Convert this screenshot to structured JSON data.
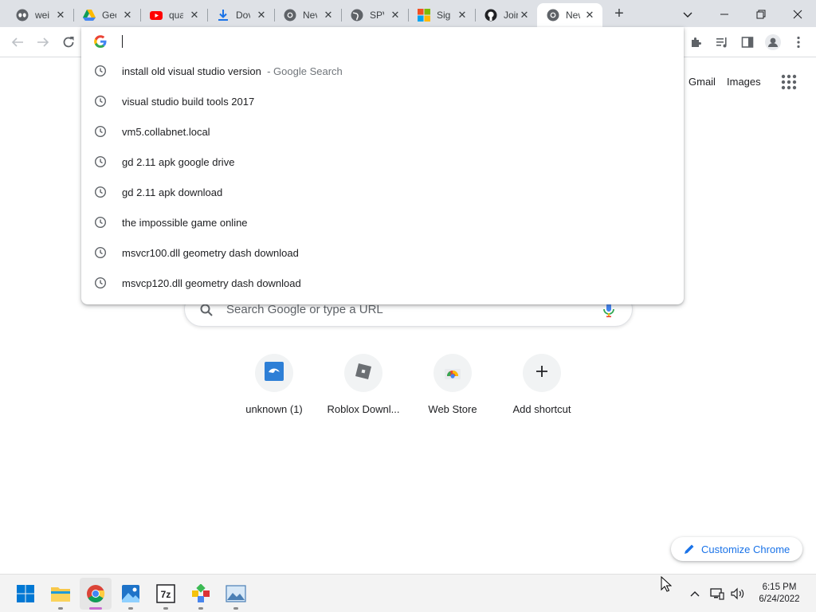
{
  "tabs": [
    {
      "title": "wei",
      "icon": "alien-face-icon"
    },
    {
      "title": "Geo",
      "icon": "google-drive-icon"
    },
    {
      "title": "qua",
      "icon": "youtube-icon"
    },
    {
      "title": "Dov",
      "icon": "download-icon"
    },
    {
      "title": "Nev",
      "icon": "chrome-icon"
    },
    {
      "title": "SPV",
      "icon": "globe-icon"
    },
    {
      "title": "Sig",
      "icon": "microsoft-icon"
    },
    {
      "title": "Join",
      "icon": "github-icon"
    },
    {
      "title": "New",
      "icon": "chrome-icon",
      "active": true
    }
  ],
  "omnibox": {
    "value": "",
    "suggestions": [
      {
        "text": "install old visual studio version",
        "suffix": "- Google Search"
      },
      {
        "text": "visual studio build tools 2017",
        "suffix": ""
      },
      {
        "text": "vm5.collabnet.local",
        "suffix": ""
      },
      {
        "text": "gd 2.11 apk google drive",
        "suffix": ""
      },
      {
        "text": "gd 2.11 apk download",
        "suffix": ""
      },
      {
        "text": "the impossible game online",
        "suffix": ""
      },
      {
        "text": "msvcr100.dll geometry dash download",
        "suffix": ""
      },
      {
        "text": "msvcp120.dll geometry dash download",
        "suffix": ""
      }
    ]
  },
  "ntp": {
    "gmail": "Gmail",
    "images": "Images",
    "search_placeholder": "Search Google or type a URL",
    "shortcuts": [
      {
        "label": "unknown (1)",
        "icon": "meduza-icon"
      },
      {
        "label": "Roblox Downl...",
        "icon": "roblox-icon"
      },
      {
        "label": "Web Store",
        "icon": "web-store-icon"
      },
      {
        "label": "Add shortcut",
        "icon": "plus-icon"
      }
    ],
    "customize": "Customize Chrome"
  },
  "taskbar": {
    "apps": [
      "windows-start-icon",
      "file-explorer-icon",
      "chrome-icon",
      "photos-icon",
      "7zip-icon",
      "game-icon",
      "image-viewer-icon"
    ],
    "time": "6:15 PM",
    "date": "6/24/2022"
  },
  "colors": {
    "tabstrip": "#dee1e6",
    "accent": "#1a73e8",
    "taskbar": "#f3f3f3"
  }
}
